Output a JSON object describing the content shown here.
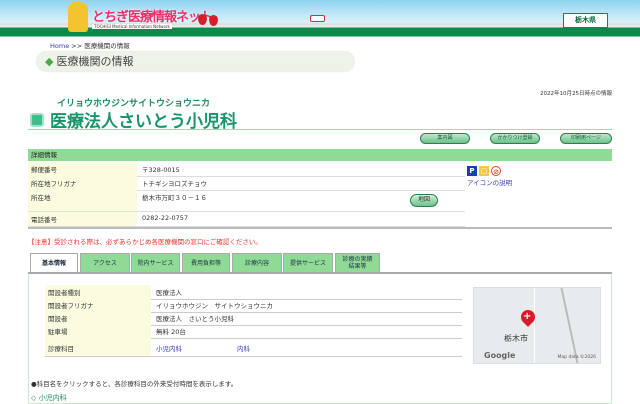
{
  "header": {
    "logo_text": "とちぎ医療情報ネット",
    "logo_sub": "TOCHIGI Medical Information Network",
    "pref_badge": "栃木県"
  },
  "breadcrumb": {
    "home": "Home",
    "sep": ">>",
    "current": "医療機関の情報"
  },
  "section_title": "医療機関の情報",
  "as_of": "2022年10月25日時点の情報",
  "facility": {
    "kana": "イリョウホウジンサイトウショウニカ",
    "name": "医療法人さいとう小児科"
  },
  "buttons": {
    "guide_map": "案内図",
    "kakaritsuke": "かかりつけ登録",
    "print": "印刷用ページ",
    "map": "地図"
  },
  "details": {
    "header": "詳細情報",
    "rows": [
      {
        "label": "郵便番号",
        "value": "〒328-0015"
      },
      {
        "label": "所在地フリガナ",
        "value": "トチギシヨロズチョウ"
      },
      {
        "label": "所在地",
        "value": "栃木市万町３０－１６"
      },
      {
        "label": "電話番号",
        "value": "0282-22-0757"
      }
    ]
  },
  "icons": {
    "items": [
      "parking-icon",
      "card-icon",
      "no-smoking-icon"
    ],
    "legend_link": "アイコンの説明"
  },
  "notice": "【注意】受診される際は、必ずあらかじめ各医療機関の窓口にご確認ください。",
  "tabs": [
    "基本情報",
    "アクセス",
    "院内サービス",
    "費用負担等",
    "診療内容",
    "提供サービス",
    "診療の実績\n結果等"
  ],
  "basic": {
    "rows": [
      {
        "label": "開設者種別",
        "value": "医療法人"
      },
      {
        "label": "開設者フリガナ",
        "value": "イリョウホウジン　サイトウショウニカ"
      },
      {
        "label": "開設者",
        "value": "医療法人　さいとう小児科"
      },
      {
        "label": "駐車場",
        "value": "無料 20台"
      }
    ],
    "departments_label": "診療科目",
    "departments": [
      "小児内科",
      "内科"
    ]
  },
  "map": {
    "city": "栃木市",
    "provider": "Google",
    "credit": "Map data ©2026"
  },
  "note": "●科目名をクリックすると、各診療科目の外来受付時間を表示します。",
  "sub_heading": "◇ 小児内科"
}
